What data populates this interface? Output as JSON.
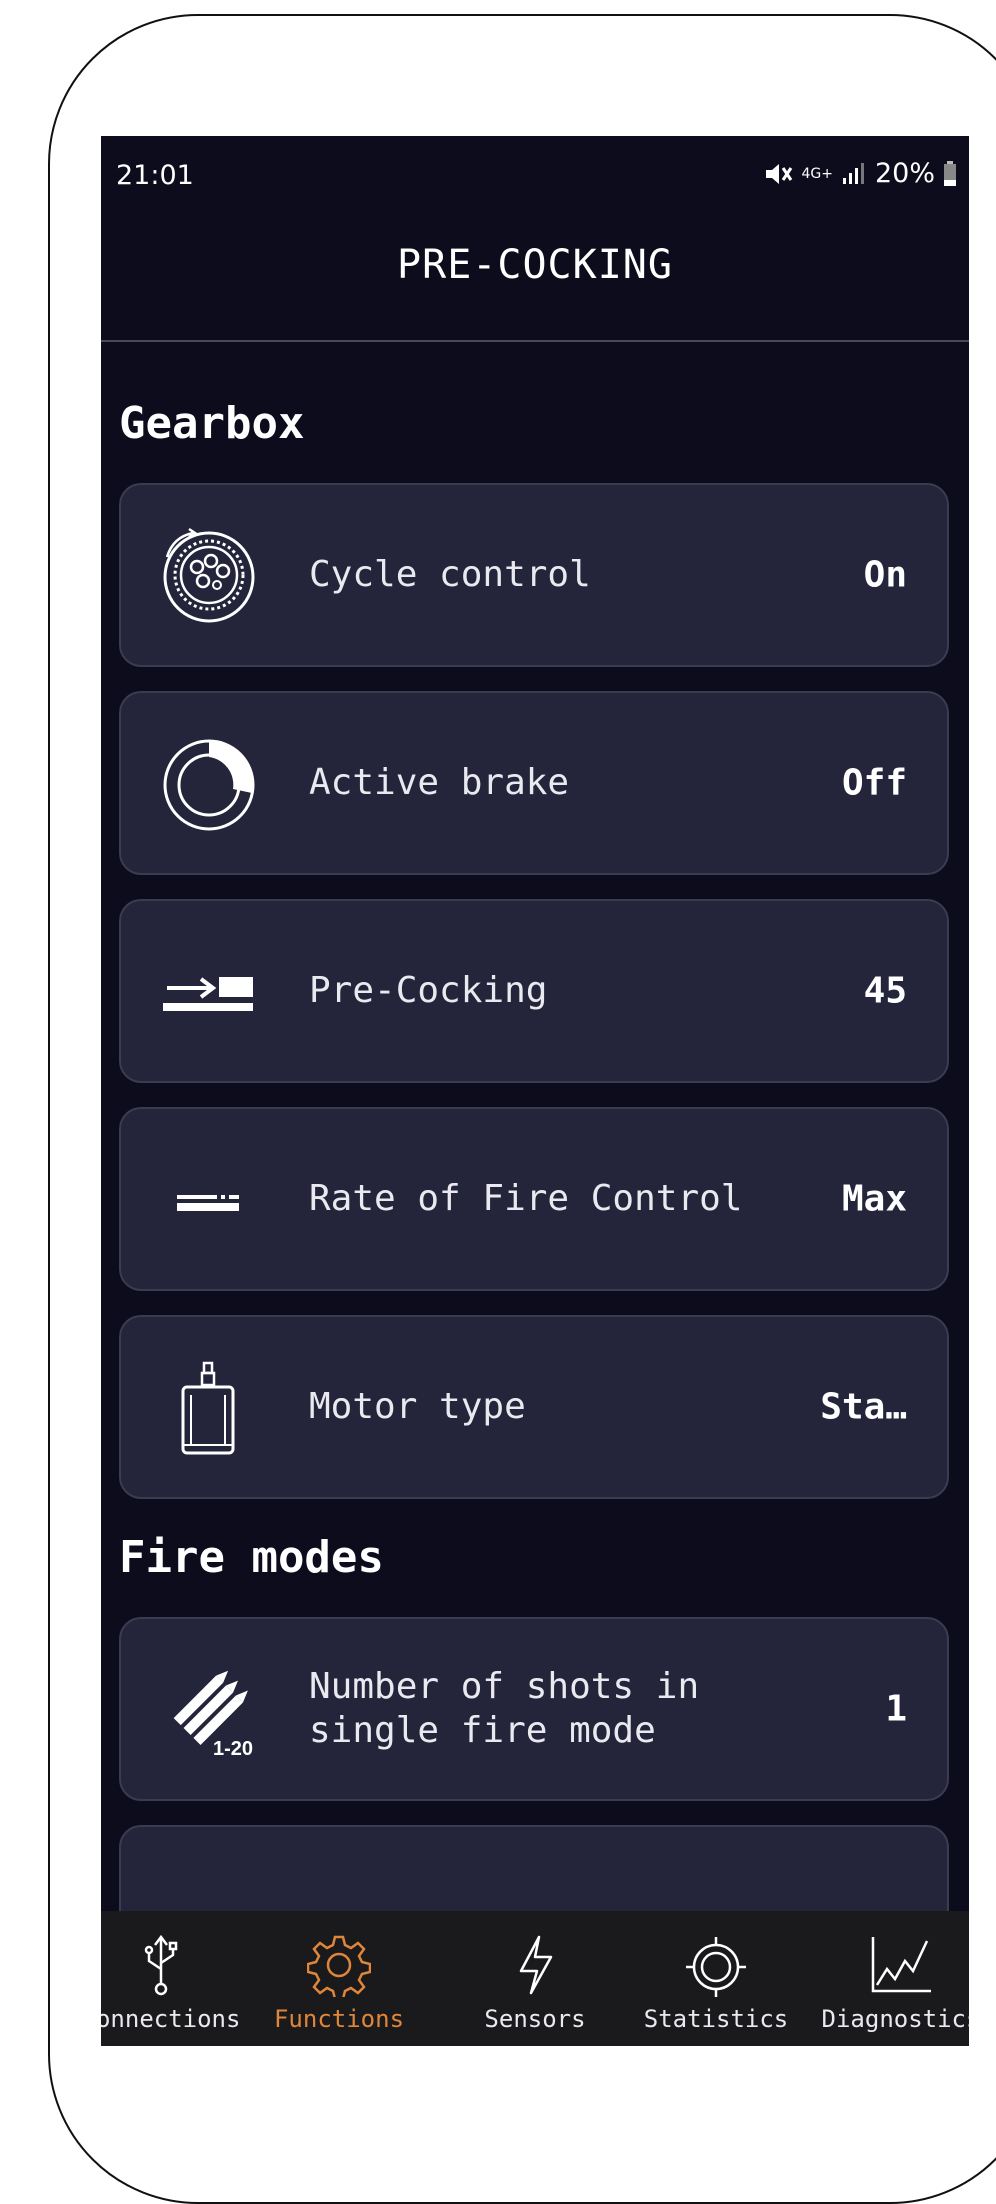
{
  "status_bar": {
    "time": "21:01",
    "network": "4G+",
    "battery": "20%"
  },
  "header": {
    "title": "PRE-COCKING"
  },
  "sections": [
    {
      "label": "Gearbox",
      "items": [
        {
          "icon": "cycle-control-icon",
          "label": "Cycle control",
          "value": "On"
        },
        {
          "icon": "active-brake-icon",
          "label": "Active brake",
          "value": "Off"
        },
        {
          "icon": "pre-cocking-icon",
          "label": "Pre-Cocking",
          "value": "45"
        },
        {
          "icon": "rate-of-fire-icon",
          "label": "Rate of Fire Control",
          "value": "Max"
        },
        {
          "icon": "motor-icon",
          "label": "Motor type",
          "value": "Sta…"
        }
      ]
    },
    {
      "label": "Fire modes",
      "items": [
        {
          "icon": "shots-icon",
          "icon_text": "1-20",
          "label": "Number of shots in\nsingle fire mode",
          "value": "1"
        }
      ]
    }
  ],
  "bottom_nav": {
    "active": "Functions",
    "items": [
      {
        "icon": "usb-icon",
        "label": "Connections"
      },
      {
        "icon": "gear-icon",
        "label": "Functions"
      },
      {
        "icon": "lightning-icon",
        "label": "Sensors"
      },
      {
        "icon": "target-icon",
        "label": "Statistics"
      },
      {
        "icon": "line-chart-icon",
        "label": "Diagnostics"
      }
    ]
  },
  "colors": {
    "background": "#0c0c1d",
    "card": "#24243b",
    "accent": "#e0863a",
    "nav": "#1a1a1d"
  }
}
